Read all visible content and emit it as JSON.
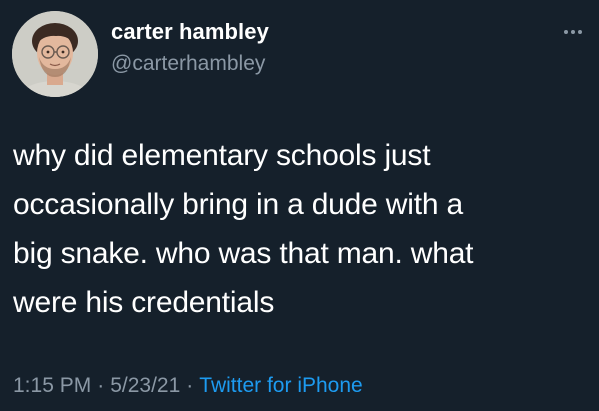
{
  "user": {
    "display_name": "carter hambley",
    "handle": "@carterhambley"
  },
  "tweet": {
    "text": "why did elementary schools just\noccasionally bring in a dude with a\nbig snake. who was that man. what\nwere his credentials"
  },
  "meta": {
    "time": "1:15 PM",
    "separator": "·",
    "date": "5/23/21",
    "source": "Twitter for iPhone"
  },
  "colors": {
    "background": "#15202b",
    "text": "#ffffff",
    "secondary": "#8b98a5",
    "link": "#1d9bf0"
  },
  "icons": {
    "more": "more-options-icon"
  }
}
